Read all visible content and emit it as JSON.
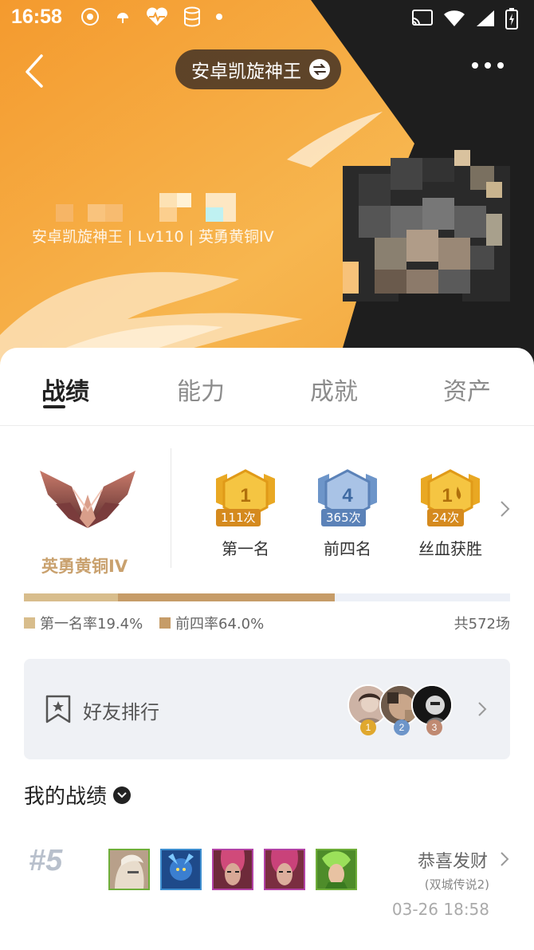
{
  "status_bar": {
    "time": "16:58"
  },
  "nav": {
    "title": "安卓凯旋神王"
  },
  "profile": {
    "subtitle": "安卓凯旋神王 | Lv110 | 英勇黄铜IV"
  },
  "tabs": [
    {
      "label": "战绩",
      "active": true
    },
    {
      "label": "能力",
      "active": false
    },
    {
      "label": "成就",
      "active": false
    },
    {
      "label": "资产",
      "active": false
    }
  ],
  "rank": {
    "label": "英勇黄铜IV"
  },
  "badges": [
    {
      "number": "1",
      "count": "111次",
      "label": "第一名",
      "color": "#e9a823"
    },
    {
      "number": "4",
      "count": "365次",
      "label": "前四名",
      "color": "#6d95c9"
    },
    {
      "number": "1",
      "count": "24次",
      "label": "丝血获胜",
      "color": "#e9a823"
    }
  ],
  "stats": {
    "first_rate_label": "第一名率19.4%",
    "top4_rate_label": "前四率64.0%",
    "total_label": "共572场",
    "first_rate": 0.194,
    "top4_rate": 0.64,
    "first_color": "#d8bd8c",
    "top4_color": "#c69c68"
  },
  "friend_rank": {
    "label": "好友排行",
    "avatars": [
      {
        "rank": "1",
        "badge_color": "#e0a82e"
      },
      {
        "rank": "2",
        "badge_color": "#6d95c9"
      },
      {
        "rank": "3",
        "badge_color": "#c08a72"
      }
    ]
  },
  "records": {
    "title": "我的战绩",
    "matches": [
      {
        "placement": "#5",
        "name": "恭喜发财",
        "mode": "(双城传说2)",
        "time": "03-26 18:58",
        "units": [
          {
            "border": "#6fae3a",
            "fill": "#c9b39b"
          },
          {
            "border": "#3f8fd0",
            "fill": "#2b5fa8"
          },
          {
            "border": "#b243a6",
            "fill": "#8c3b4c"
          },
          {
            "border": "#b243a6",
            "fill": "#9a4456"
          },
          {
            "border": "#6fae3a",
            "fill": "#7cc04a"
          }
        ]
      }
    ]
  }
}
